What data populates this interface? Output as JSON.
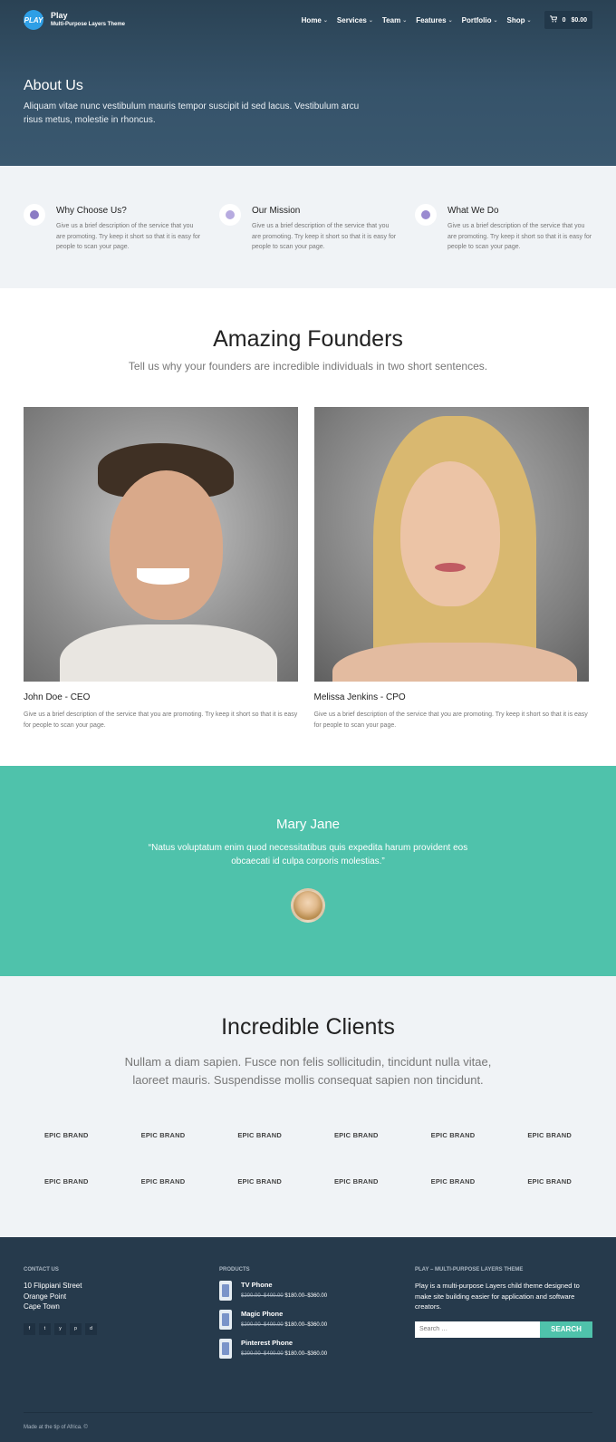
{
  "header": {
    "brand_title": "Play",
    "brand_subtitle": "Multi-Purpose Layers Theme",
    "logo_text": "PLAY",
    "menu": [
      {
        "label": "Home"
      },
      {
        "label": "Services"
      },
      {
        "label": "Team"
      },
      {
        "label": "Features"
      },
      {
        "label": "Portfolio"
      },
      {
        "label": "Shop"
      }
    ],
    "cart_count": "0",
    "cart_total": "$0.00"
  },
  "hero": {
    "title": "About Us",
    "text": "Aliquam vitae nunc vestibulum mauris tempor suscipit id sed lacus. Vestibulum arcu risus metus, molestie in rhoncus."
  },
  "features": [
    {
      "title": "Why Choose Us?",
      "desc": "Give us a brief description of the service that you are promoting. Try keep it short so that it is easy for people to scan your page.",
      "icon": "shield-icon"
    },
    {
      "title": "Our Mission",
      "desc": "Give us a brief description of the service that you are promoting. Try keep it short so that it is easy for people to scan your page.",
      "icon": "gear-icon"
    },
    {
      "title": "What We Do",
      "desc": "Give us a brief description of the service that you are promoting. Try keep it short so that it is easy for people to scan your page.",
      "icon": "cog-icon"
    }
  ],
  "founders": {
    "title": "Amazing Founders",
    "subtitle": "Tell us why your founders are incredible individuals in two short sentences.",
    "people": [
      {
        "name": "John Doe - CEO",
        "desc": "Give us a brief description of the service that you are promoting. Try keep it short so that it is easy for people to scan your page."
      },
      {
        "name": "Melissa Jenkins - CPO",
        "desc": "Give us a brief description of the service that you are promoting. Try keep it short so that it is easy for people to scan your page."
      }
    ]
  },
  "testimonial": {
    "name": "Mary Jane",
    "quote": "“Natus voluptatum enim quod necessitatibus quis expedita harum provident eos obcaecati id culpa corporis molestias.”"
  },
  "clients": {
    "title": "Incredible Clients",
    "subtitle": "Nullam a diam sapien. Fusce non felis sollicitudin, tincidunt nulla vitae, laoreet mauris. Suspendisse mollis consequat sapien non tincidunt.",
    "brands": [
      "EPIC BRAND",
      "EPIC BRAND",
      "EPIC BRAND",
      "EPIC BRAND",
      "EPIC BRAND",
      "EPIC BRAND",
      "EPIC BRAND",
      "EPIC BRAND",
      "EPIC BRAND",
      "EPIC BRAND",
      "EPIC BRAND",
      "EPIC BRAND"
    ]
  },
  "footer": {
    "contact_heading": "CONTACT US",
    "address": [
      "10 Flippiani Street",
      "Orange Point",
      "Cape Town"
    ],
    "socials": [
      "f",
      "t",
      "y",
      "p",
      "d"
    ],
    "products_heading": "PRODUCTS",
    "products": [
      {
        "name": "TV Phone",
        "old_price": "$200.00–$400.00",
        "new_price": "$180.00–$360.00"
      },
      {
        "name": "Magic Phone",
        "old_price": "$200.00–$400.00",
        "new_price": "$180.00–$360.00"
      },
      {
        "name": "Pinterest Phone",
        "old_price": "$200.00–$400.00",
        "new_price": "$180.00–$360.00"
      }
    ],
    "about_heading": "PLAY – MULTI-PURPOSE LAYERS THEME",
    "about_text": "Play is a multi-purpose Layers child theme designed to make site building easier for application and software creators.",
    "search_placeholder": "Search …",
    "search_button": "SEARCH",
    "bottom_text": "Made at the tip of Africa. ©"
  },
  "colors": {
    "accent": "#4fc2ab",
    "header_bg": "#36536a",
    "footer_bg": "#263a4c",
    "section_bg": "#f0f3f6"
  }
}
